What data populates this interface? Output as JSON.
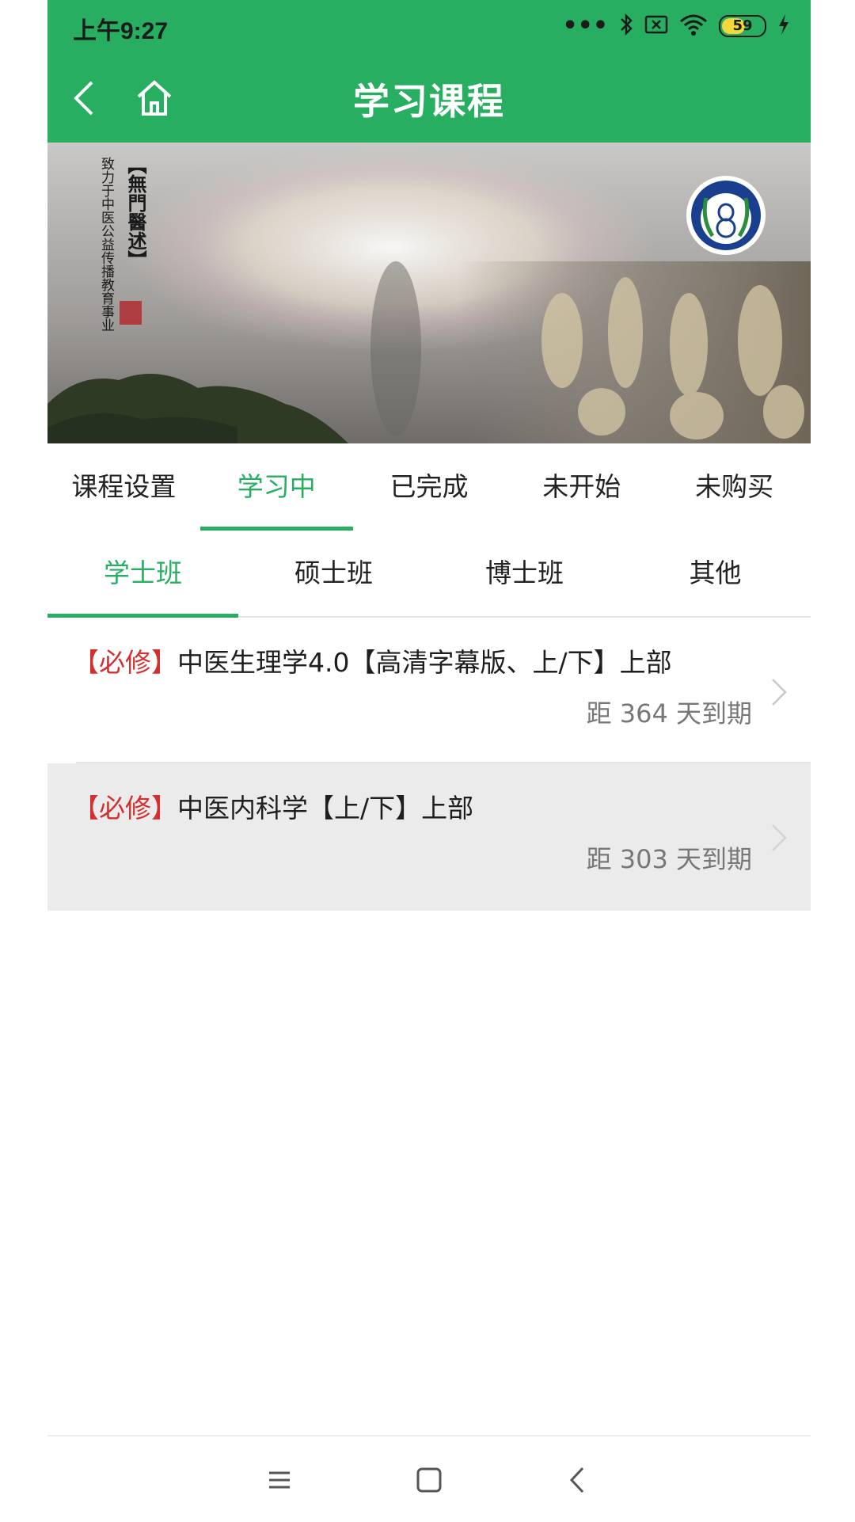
{
  "status": {
    "time": "上午9:27",
    "battery": "59"
  },
  "header": {
    "title": "学习课程"
  },
  "banner": {
    "vertical_title": "【無門醫述】",
    "vertical_subtitle": "致力于中医公益传播教育事业"
  },
  "tabs_primary": [
    {
      "label": "课程设置",
      "active": false
    },
    {
      "label": "学习中",
      "active": true
    },
    {
      "label": "已完成",
      "active": false
    },
    {
      "label": "未开始",
      "active": false
    },
    {
      "label": "未购买",
      "active": false
    }
  ],
  "tabs_secondary": [
    {
      "label": "学士班",
      "active": true
    },
    {
      "label": "硕士班",
      "active": false
    },
    {
      "label": "博士班",
      "active": false
    },
    {
      "label": "其他",
      "active": false
    }
  ],
  "courses": [
    {
      "tag": "【必修】",
      "name": "中医生理学4.0【高清字幕版、上/下】上部",
      "expire": "距 364 天到期"
    },
    {
      "tag": "【必修】",
      "name": "中医内科学【上/下】上部",
      "expire": "距 303 天到期"
    }
  ],
  "colors": {
    "accent": "#27ae60",
    "tag_red": "#d32f2f"
  }
}
